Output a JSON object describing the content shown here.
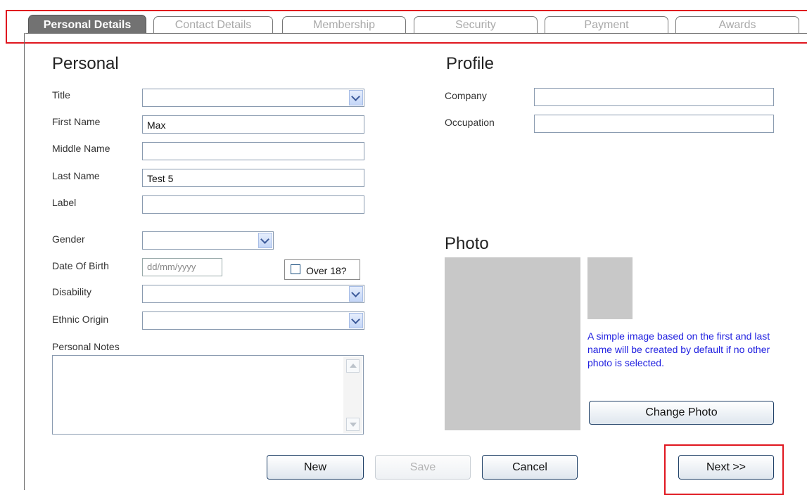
{
  "tabs": [
    {
      "label": "Personal Details",
      "active": true
    },
    {
      "label": "Contact Details",
      "active": false
    },
    {
      "label": "Membership",
      "active": false
    },
    {
      "label": "Security",
      "active": false
    },
    {
      "label": "Payment",
      "active": false
    },
    {
      "label": "Awards",
      "active": false
    }
  ],
  "personal": {
    "heading": "Personal",
    "title_label": "Title",
    "title_value": "",
    "first_name_label": "First Name",
    "first_name_value": "Max",
    "middle_name_label": "Middle Name",
    "middle_name_value": "",
    "last_name_label": "Last Name",
    "last_name_value": "Test 5",
    "label_label": "Label",
    "label_value": "",
    "gender_label": "Gender",
    "gender_value": "",
    "dob_label": "Date Of Birth",
    "dob_placeholder": "dd/mm/yyyy",
    "over18_label": "Over 18?",
    "over18_checked": false,
    "disability_label": "Disability",
    "disability_value": "",
    "ethnic_label": "Ethnic Origin",
    "ethnic_value": "",
    "notes_label": "Personal Notes",
    "notes_value": ""
  },
  "profile": {
    "heading": "Profile",
    "company_label": "Company",
    "company_value": "",
    "occupation_label": "Occupation",
    "occupation_value": ""
  },
  "photo": {
    "heading": "Photo",
    "note": "A simple image based on the first and last name will be created by default if no other photo is selected.",
    "change_button": "Change Photo"
  },
  "actions": {
    "new_label": "New",
    "save_label": "Save",
    "cancel_label": "Cancel",
    "next_label": "Next >>"
  },
  "colors": {
    "highlight": "#e0161f",
    "active_tab": "#727272",
    "note_text": "#1f1fe0",
    "photo_placeholder": "#c8c8c8"
  }
}
